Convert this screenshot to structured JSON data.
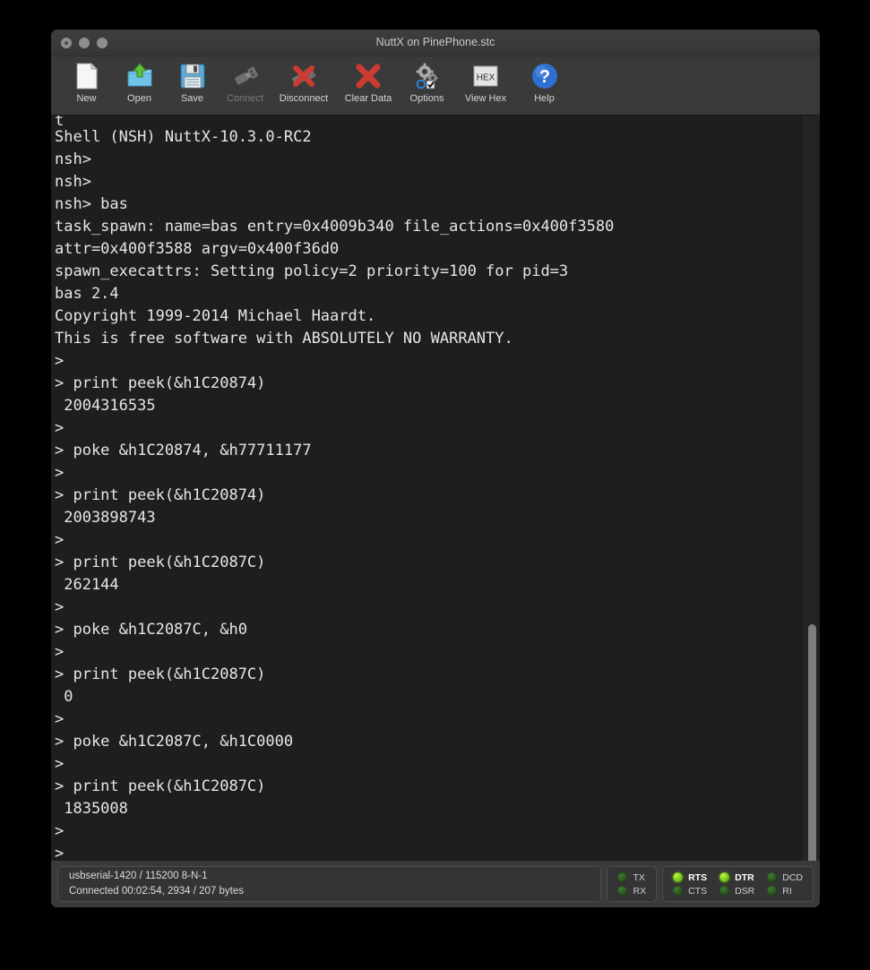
{
  "window": {
    "title": "NuttX on PinePhone.stc",
    "traffic_lights": [
      "close",
      "minimize",
      "maximize"
    ]
  },
  "toolbar": {
    "items": [
      {
        "label": "New",
        "icon": "new-document-icon",
        "disabled": false
      },
      {
        "label": "Open",
        "icon": "open-folder-icon",
        "disabled": false
      },
      {
        "label": "Save",
        "icon": "save-floppy-icon",
        "disabled": false
      },
      {
        "label": "Connect",
        "icon": "usb-connect-icon",
        "disabled": true
      },
      {
        "label": "Disconnect",
        "icon": "usb-disconnect-icon",
        "disabled": false
      },
      {
        "label": "Clear Data",
        "icon": "red-x-icon",
        "disabled": false
      },
      {
        "label": "Options",
        "icon": "gear-options-icon",
        "disabled": false
      },
      {
        "label": "View Hex",
        "icon": "hex-view-icon",
        "disabled": false
      },
      {
        "label": "Help",
        "icon": "help-question-icon",
        "disabled": false
      }
    ],
    "hex_icon_text": "HEX",
    "help_icon_text": "?"
  },
  "terminal": {
    "lines": [
      "t",
      "Shell (NSH) NuttX-10.3.0-RC2",
      "nsh>",
      "nsh>",
      "nsh> bas",
      "task_spawn: name=bas entry=0x4009b340 file_actions=0x400f3580",
      "attr=0x400f3588 argv=0x400f36d0",
      "spawn_execattrs: Setting policy=2 priority=100 for pid=3",
      "bas 2.4",
      "Copyright 1999-2014 Michael Haardt.",
      "This is free software with ABSOLUTELY NO WARRANTY.",
      ">",
      "> print peek(&h1C20874)",
      " 2004316535",
      ">",
      "> poke &h1C20874, &h77711177",
      ">",
      "> print peek(&h1C20874)",
      " 2003898743",
      ">",
      "> print peek(&h1C2087C)",
      " 262144",
      ">",
      "> poke &h1C2087C, &h0",
      ">",
      "> print peek(&h1C2087C)",
      " 0",
      ">",
      "> poke &h1C2087C, &h1C0000",
      ">",
      "> print peek(&h1C2087C)",
      " 1835008",
      ">",
      ">"
    ],
    "background": "#1e1e1e",
    "foreground": "#e6e6e6"
  },
  "statusbar": {
    "connection": {
      "port_line": "usbserial-1420 / 115200 8-N-1",
      "status_line": "Connected 00:02:54, 2934 / 207 bytes"
    },
    "txrx_leds": [
      {
        "label": "TX",
        "on": false
      },
      {
        "label": "RX",
        "on": false
      }
    ],
    "modem_leds": [
      {
        "label": "RTS",
        "on": true
      },
      {
        "label": "CTS",
        "on": false
      },
      {
        "label": "DTR",
        "on": true
      },
      {
        "label": "DSR",
        "on": false
      },
      {
        "label": "DCD",
        "on": false
      },
      {
        "label": "RI",
        "on": false
      }
    ]
  },
  "colors": {
    "window_chrome": "#3a3a3a",
    "terminal_bg": "#1e1e1e",
    "led_on": "#7ed220",
    "led_off": "#2a5a20",
    "accent_red": "#cc3b32",
    "accent_blue": "#2f6fd0"
  }
}
